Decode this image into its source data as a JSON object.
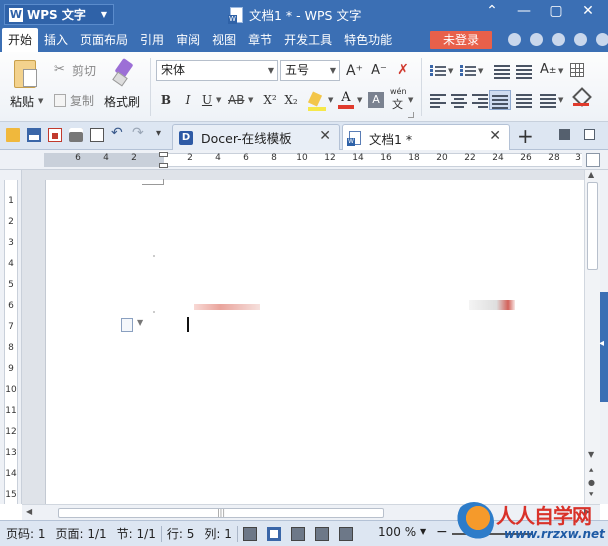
{
  "app": {
    "name": "WPS 文字",
    "window_title": "文档1 * - WPS 文字",
    "controls": [
      "⌃",
      "—",
      "▢",
      "✕"
    ]
  },
  "menu": {
    "items": [
      "开始",
      "插入",
      "页面布局",
      "引用",
      "审阅",
      "视图",
      "章节",
      "开发工具",
      "特色功能"
    ],
    "active": "开始",
    "login_label": "未登录"
  },
  "ribbon": {
    "paste_label": "粘贴",
    "cut_label": "剪切",
    "copy_label": "复制",
    "format_painter_label": "格式刷",
    "font_name": "宋体",
    "font_size": "五号",
    "grow_font": "A⁺",
    "shrink_font": "A⁻",
    "bold": "B",
    "italic": "I",
    "underline": "U",
    "strikethrough": "AB",
    "superscript": "X²",
    "subscript": "X₂",
    "font_color_letter": "A",
    "shade_letter": "A",
    "phonetic_top": "wén",
    "phonetic_bottom": "文"
  },
  "tabs": {
    "items": [
      {
        "label": "Docer-在线模板",
        "active": false
      },
      {
        "label": "文档1 *",
        "active": true
      }
    ],
    "add_label": "+"
  },
  "ruler": {
    "h_ticks": [
      "6",
      "4",
      "2",
      "2",
      "4",
      "6",
      "8",
      "10",
      "12",
      "14",
      "16",
      "18",
      "20",
      "22",
      "24",
      "26",
      "28",
      "3"
    ],
    "v_ticks": [
      "1",
      "2",
      "3",
      "4",
      "5",
      "6",
      "7",
      "8",
      "9",
      "10",
      "11",
      "12",
      "13",
      "14",
      "15"
    ]
  },
  "status": {
    "page_num": "页码: 1",
    "pages": "页面: 1/1",
    "section": "节: 1/1",
    "row": "行: 5",
    "column": "列: 1",
    "zoom": "100 %"
  },
  "watermark": {
    "title": "人人自学网",
    "url": "www.rrzxw.net"
  },
  "colors": {
    "titlebar": "#3b6fb4",
    "login_button": "#e8604a",
    "accent": "#2f62a8"
  }
}
